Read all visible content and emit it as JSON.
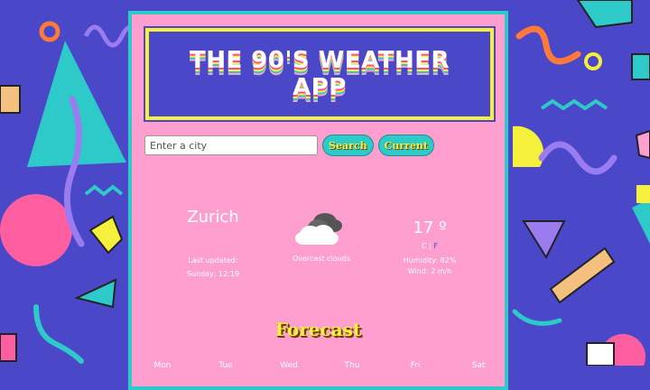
{
  "app": {
    "title": "THE 90'S WEATHER APP"
  },
  "search": {
    "placeholder": "Enter a city",
    "search_label": "Search",
    "current_label": "Current"
  },
  "current": {
    "city": "Zurich",
    "updated_line1": "Last updated:",
    "updated_line2": "Sunday, 12:19",
    "condition_icon": "overcast-cloud-icon",
    "description": "Overcast clouds",
    "temperature": "17 º",
    "unit_c": "C",
    "unit_sep": "|",
    "unit_f": "F",
    "humidity": "Humidity: 82%",
    "wind": "Wind: 2 m/h"
  },
  "forecast": {
    "title": "Forecast",
    "days": [
      "Mon",
      "Tue",
      "Wed",
      "Thu",
      "Fri",
      "Sat"
    ]
  },
  "colors": {
    "background": "#4a47c9",
    "card": "#ff9fcf",
    "accent_teal": "#2ec9c9",
    "accent_yellow": "#f4f03c"
  }
}
